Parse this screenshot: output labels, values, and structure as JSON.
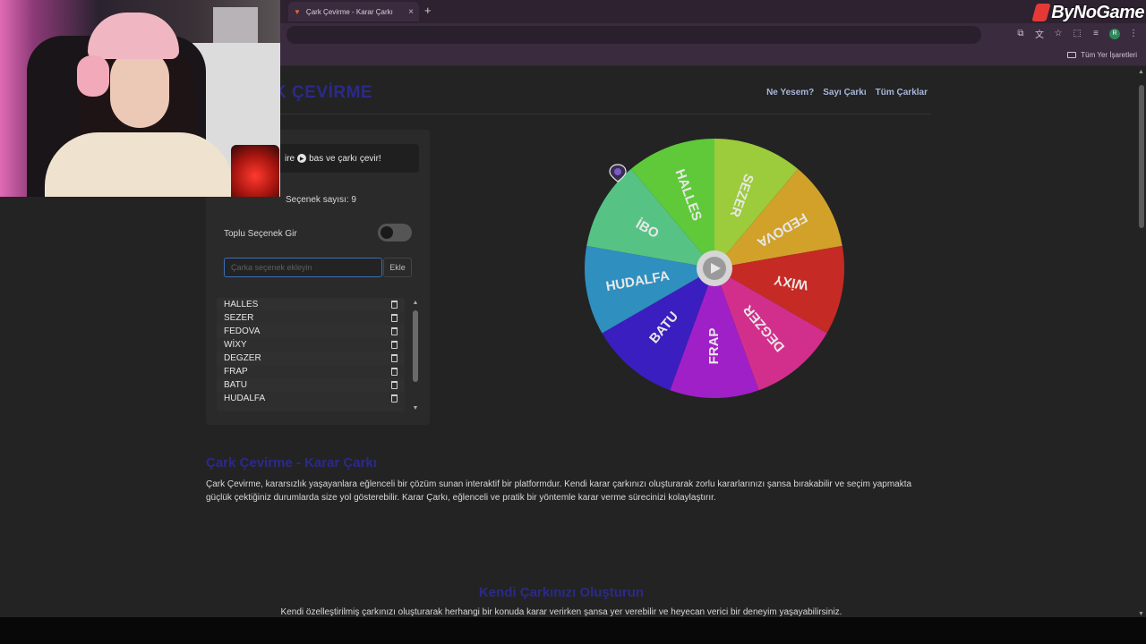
{
  "watermark": {
    "text": "ByNoGame"
  },
  "browser": {
    "tab_title": "Çark Çevirme - Karar Çarkı",
    "tab_close": "×",
    "new_tab": "+",
    "bookmarks_folder": "Tüm Yer İşaretleri",
    "profile_initial": "R"
  },
  "site": {
    "logo": "K ÇEVİRME",
    "nav": [
      "Ne Yesem?",
      "Sayı Çarkı",
      "Tüm Çarklar"
    ]
  },
  "panel": {
    "hint_prefix": "ire",
    "hint_suffix": "bas ve çarkı çevir!",
    "count_label": "Seçenek sayısı: 9",
    "toggle_label": "Toplu Seçenek Gir",
    "toggle_on": false,
    "input_placeholder": "Çarka seçenek ekleyin",
    "add_button": "Ekle",
    "items": [
      "HALLES",
      "SEZER",
      "FEDOVA",
      "WİXY",
      "DEGZER",
      "FRAP",
      "BATU",
      "HUDALFA"
    ]
  },
  "wheel": {
    "segments": [
      {
        "label": "HALLES",
        "color": "#5fc93a"
      },
      {
        "label": "SEZER",
        "color": "#9ccb3b"
      },
      {
        "label": "FEDOVA",
        "color": "#d1a12a"
      },
      {
        "label": "WİXY",
        "color": "#c62a24"
      },
      {
        "label": "DEGZER",
        "color": "#d22f8c"
      },
      {
        "label": "FRAP",
        "color": "#a020c7"
      },
      {
        "label": "BATU",
        "color": "#3b1ec0"
      },
      {
        "label": "HUDALFA",
        "color": "#2f8fbf"
      },
      {
        "label": "İBO",
        "color": "#56c385"
      }
    ],
    "label_color": "#e8e8e8"
  },
  "content": {
    "heading1": "Çark Çevirme - Karar Çarkı",
    "paragraph1": "Çark Çevirme, kararsızlık yaşayanlara eğlenceli bir çözüm sunan interaktif bir platformdur. Kendi karar çarkınızı oluşturarak zorlu kararlarınızı şansa bırakabilir ve seçim yapmakta güçlük çektiğiniz durumlarda size yol gösterebilir. Karar Çarkı, eğlenceli ve pratik bir yöntemle karar verme sürecinizi kolaylaştırır.",
    "heading2": "Kendi Çarkınızı Oluşturun",
    "paragraph2": "Kendi özelleştirilmiş çarkınızı oluşturarak herhangi bir konuda karar verirken şansa yer verebilir ve heyecan verici bir deneyim yaşayabilirsiniz."
  }
}
